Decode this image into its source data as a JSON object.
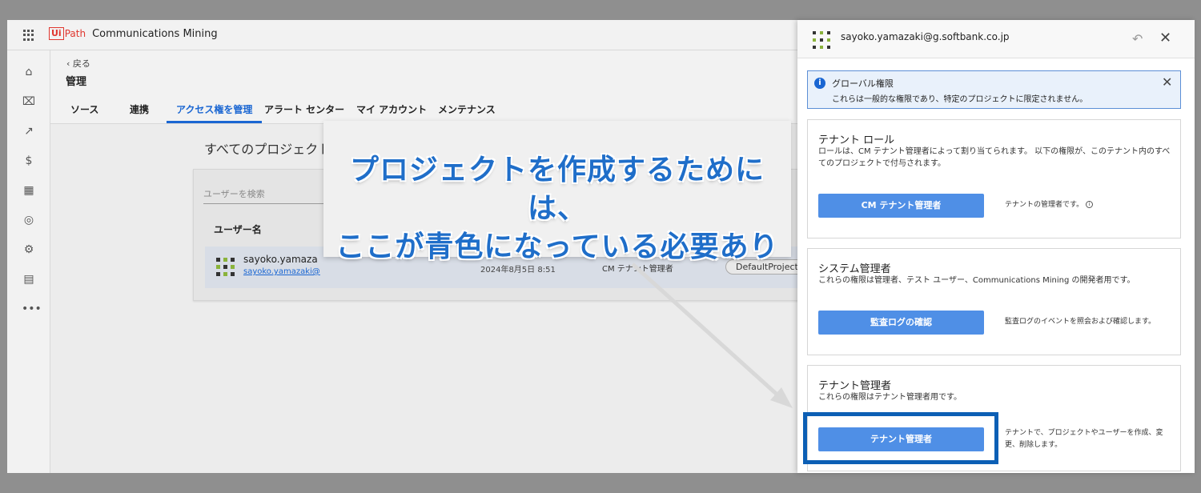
{
  "app": {
    "logo_ui": "Ui",
    "logo_path": "Path",
    "product": "Communications Mining"
  },
  "rail": {
    "icons": [
      "home-icon",
      "bug-icon",
      "chart-icon",
      "currency-icon",
      "qr-icon",
      "signal-icon",
      "settings-icon",
      "building-icon",
      "more-icon"
    ]
  },
  "header": {
    "back": "‹ 戻る",
    "title": "管理",
    "tabs": [
      "ソース",
      "連携",
      "アクセス権を管理",
      "アラート センター",
      "マイ アカウント",
      "メンテナンス"
    ],
    "active_tab": 2
  },
  "main": {
    "section_title": "すべてのプロジェクト",
    "search_placeholder": "ユーザーを検索",
    "column_user": "ユーザー名",
    "row": {
      "name": "sayoko.yamaza",
      "email": "sayoko.yamazaki@",
      "date": "2024年8月5日 8:51",
      "role": "CM テナント管理者",
      "project": "DefaultProject"
    }
  },
  "callout": {
    "line1": "プロジェクトを作成するためには、",
    "line2": "ここが青色になっている必要あり"
  },
  "panel": {
    "email": "sayoko.yamazaki@g.softbank.co.jp",
    "notice": {
      "title": "グローバル権限",
      "body": "これらは一般的な権限であり、特定のプロジェクトに限定されません。"
    },
    "sections": [
      {
        "title": "テナント ロール",
        "desc": "ロールは、CM テナント管理者によって割り当てられます。 以下の権限が、このテナント内のすべてのプロジェクトで付与されます。",
        "button": "CM テナント管理者",
        "perm_desc": "テナントの管理者です。"
      },
      {
        "title": "システム管理者",
        "desc": "これらの権限は管理者、テスト ユーザー、Communications Mining の開発者用です。",
        "button": "監査ログの確認",
        "perm_desc": "監査ログのイベントを照会および確認します。"
      },
      {
        "title": "テナント管理者",
        "desc": "これらの権限はテナント管理者用です。",
        "button": "テナント管理者",
        "perm_desc": "テナントで、プロジェクトやユーザーを作成、変更、削除します。"
      }
    ]
  },
  "colors": {
    "accent": "#1a66d2",
    "permission_button": "#4f8fe6",
    "callout_text": "#1f6ec9",
    "highlight_border": "#0c5fb5",
    "brand": "#e0372f"
  }
}
